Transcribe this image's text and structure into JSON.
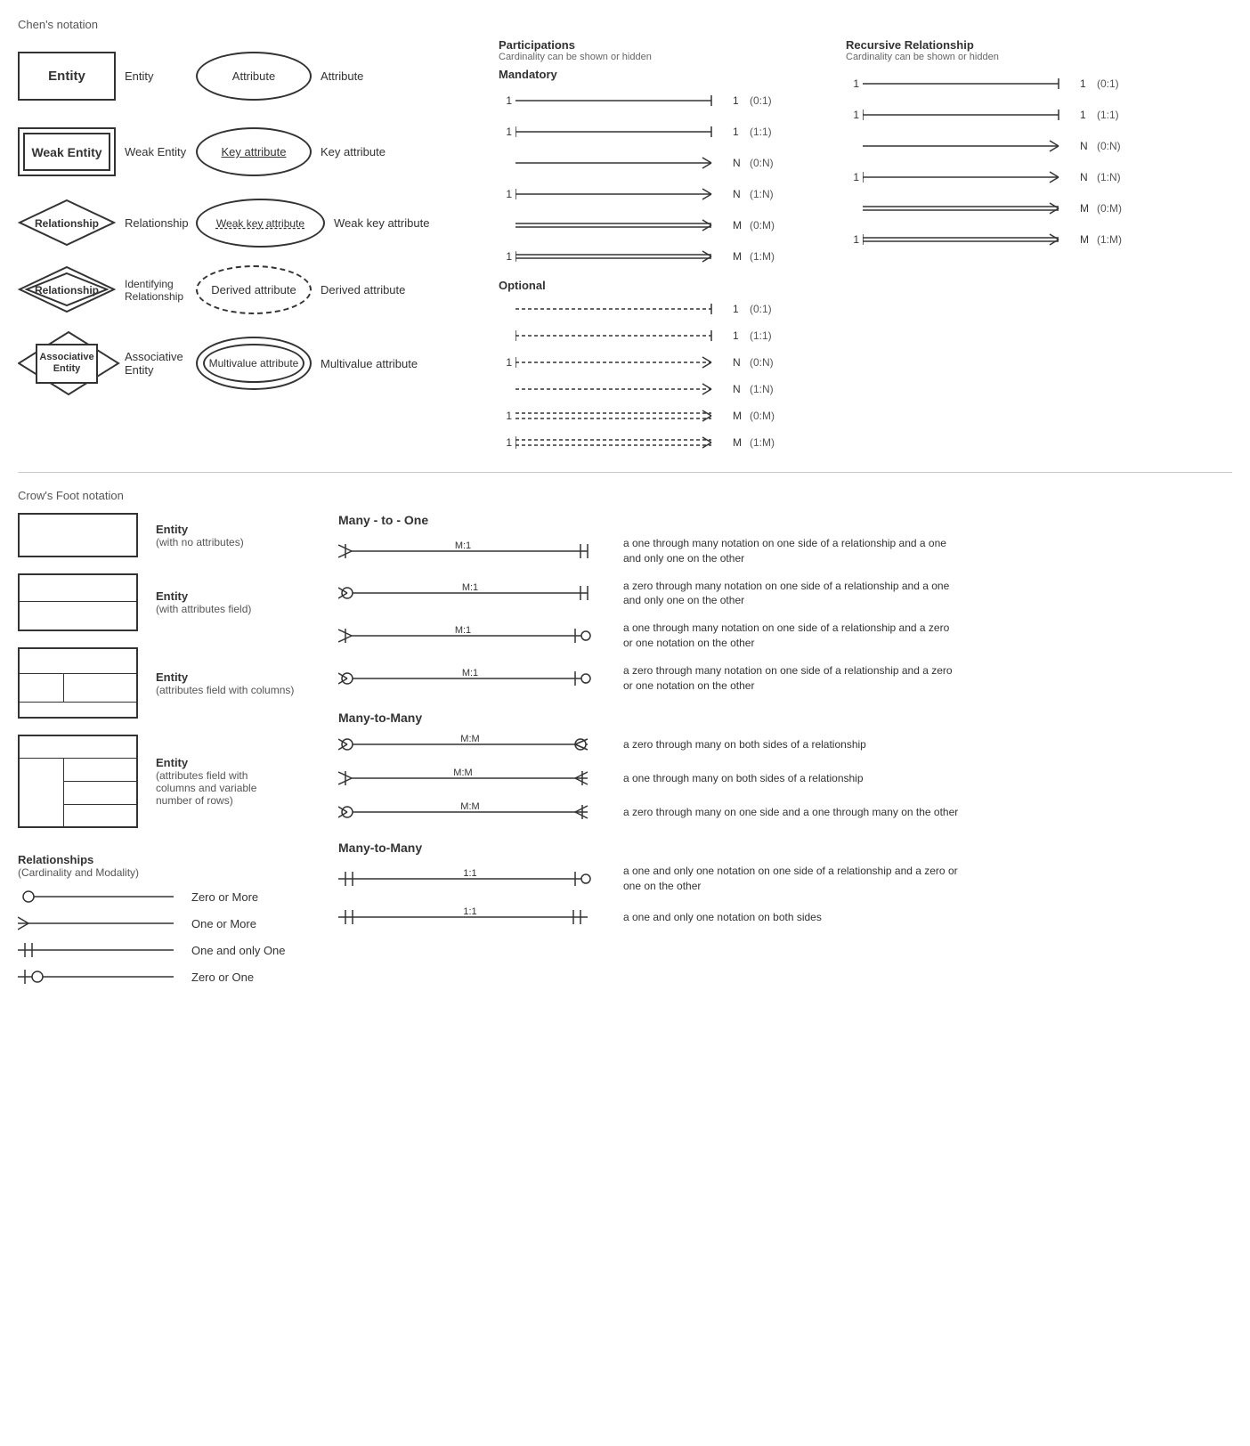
{
  "chens": {
    "section_title": "Chen's notation",
    "rows": [
      {
        "id": "entity",
        "shape_label": "Entity",
        "shape_type": "entity",
        "label": "Entity"
      },
      {
        "id": "weak-entity",
        "shape_label": "Weak Entity",
        "shape_type": "weak-entity",
        "label": "Weak Entity"
      },
      {
        "id": "relationship",
        "shape_label": "Relationship",
        "shape_type": "diamond",
        "label": "Relationship"
      },
      {
        "id": "identifying-relationship",
        "shape_label": "Relationship",
        "shape_type": "diamond-double",
        "label": "Identifying Relationship"
      },
      {
        "id": "associative-entity",
        "shape_label": "Associative\nEntity",
        "shape_type": "associative",
        "label": "Associative Entity"
      }
    ],
    "attr_rows": [
      {
        "id": "attribute",
        "shape_label": "Attribute",
        "shape_type": "oval",
        "label": "Attribute"
      },
      {
        "id": "key-attribute",
        "shape_label": "Key attribute",
        "shape_type": "oval-key",
        "label": "Key attribute"
      },
      {
        "id": "weak-key-attribute",
        "shape_label": "Weak key attribute",
        "shape_type": "oval-weak-key",
        "label": "Weak key attribute"
      },
      {
        "id": "derived-attribute",
        "shape_label": "Derived attribute",
        "shape_type": "oval-derived",
        "label": "Derived attribute"
      },
      {
        "id": "multivalue-attribute",
        "shape_label": "Multivalue attribute",
        "shape_type": "oval-multi",
        "label": "Multivalue attribute"
      }
    ]
  },
  "participations": {
    "title": "Participations",
    "subtitle": "Cardinality can be shown or hidden",
    "mandatory_label": "Mandatory",
    "optional_label": "Optional",
    "mandatory_rows": [
      {
        "left": "1",
        "right": "1",
        "notation": "(0:1)"
      },
      {
        "left": "1",
        "right": "1",
        "notation": "(1:1)"
      },
      {
        "left": "",
        "right": "N",
        "notation": "(0:N)"
      },
      {
        "left": "1",
        "right": "N",
        "notation": "(1:N)"
      },
      {
        "left": "",
        "right": "M",
        "notation": "(0:M)"
      },
      {
        "left": "1",
        "right": "M",
        "notation": "(1:M)"
      }
    ],
    "optional_rows": [
      {
        "left": "",
        "right": "1",
        "notation": "(0:1)"
      },
      {
        "left": "",
        "right": "1",
        "notation": "(1:1)"
      },
      {
        "left": "1",
        "right": "N",
        "notation": "(0:N)"
      },
      {
        "left": "",
        "right": "N",
        "notation": "(1:N)"
      },
      {
        "left": "1",
        "right": "M",
        "notation": "(0:M)"
      },
      {
        "left": "1",
        "right": "M",
        "notation": "(1:M)"
      }
    ]
  },
  "recursive": {
    "title": "Recursive Relationship",
    "subtitle": "Cardinality can be shown or hidden",
    "rows": [
      {
        "left": "1",
        "right": "1",
        "notation": "(0:1)"
      },
      {
        "left": "1",
        "right": "1",
        "notation": "(1:1)"
      },
      {
        "left": "",
        "right": "N",
        "notation": "(0:N)"
      },
      {
        "left": "1",
        "right": "N",
        "notation": "(1:N)"
      },
      {
        "left": "",
        "right": "M",
        "notation": "(0:M)"
      },
      {
        "left": "1",
        "right": "M",
        "notation": "(1:M)"
      }
    ]
  },
  "crows": {
    "section_title": "Crow's Foot notation",
    "entities": [
      {
        "type": "simple",
        "label": "Entity",
        "sublabel": "(with no attributes)"
      },
      {
        "type": "attr",
        "label": "Entity",
        "sublabel": "(with attributes field)"
      },
      {
        "type": "cols",
        "label": "Entity",
        "sublabel": "(attributes field with columns)"
      },
      {
        "type": "var",
        "label": "Entity",
        "sublabel": "(attributes field with columns and\nvariable number of rows)"
      }
    ],
    "relationships_label": "Relationships",
    "relationships_sublabel": "(Cardinality and Modality)",
    "rel_symbols": [
      {
        "type": "zero-or-more",
        "label": "Zero or More"
      },
      {
        "type": "one-or-more",
        "label": "One or More"
      },
      {
        "type": "one-only",
        "label": "One and only One"
      },
      {
        "type": "zero-or-one",
        "label": "Zero or One"
      }
    ],
    "many_to_one_title": "Many - to - One",
    "many_to_one_rows": [
      {
        "left_type": "one-or-more",
        "label": "M:1",
        "right_type": "one-only",
        "desc": "a one through many notation on one side of a relationship and a one and only one on the other"
      },
      {
        "left_type": "zero-or-more",
        "label": "M:1",
        "right_type": "one-only",
        "desc": "a zero through many notation on one side of a relationship and a one and only one on the other"
      },
      {
        "left_type": "one-or-more",
        "label": "M:1",
        "right_type": "zero-or-one",
        "desc": "a one through many notation on one side of a relationship and a zero or one notation on the other"
      },
      {
        "left_type": "zero-or-more",
        "label": "M:1",
        "right_type": "zero-or-one",
        "desc": "a zero through many notation on one side of a relationship and a zero or one notation on the other"
      }
    ],
    "many_to_many_title": "Many-to-Many",
    "many_to_many_rows": [
      {
        "left_type": "zero-or-more",
        "label": "M:M",
        "right_type": "zero-or-more",
        "desc": "a zero through many on both sides of a relationship"
      },
      {
        "left_type": "one-or-more",
        "label": "M:M",
        "right_type": "one-or-more",
        "desc": "a one through many on both sides of a relationship"
      },
      {
        "left_type": "zero-or-more",
        "label": "M:M",
        "right_type": "one-or-more",
        "desc": "a zero through many on one side and a one through many on the other"
      }
    ],
    "many_to_many2_title": "Many-to-Many",
    "one_to_one_rows": [
      {
        "left_type": "one-only",
        "label": "1:1",
        "right_type": "zero-or-one",
        "desc": "a one and only one notation on one side of a relationship and a zero or one on the other"
      },
      {
        "left_type": "one-only",
        "label": "1:1",
        "right_type": "one-only",
        "desc": "a one and only one notation on both sides"
      }
    ]
  }
}
